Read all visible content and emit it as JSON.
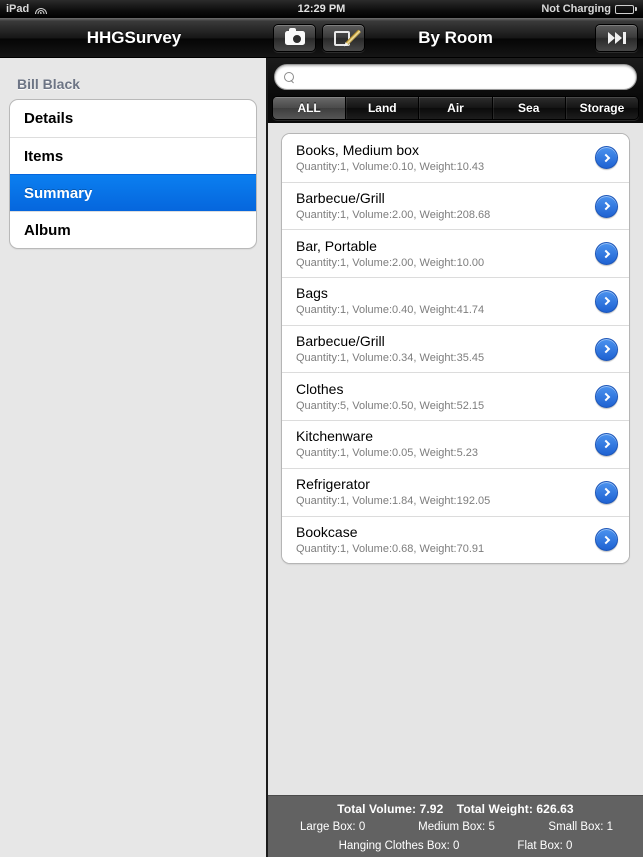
{
  "statusbar": {
    "device_label": "iPad",
    "wifi_icon": "wifi-icon",
    "time": "12:29 PM",
    "battery_label": "Not Charging",
    "battery_icon": "battery-icon"
  },
  "sidebar_navbar": {
    "title": "HHGSurvey"
  },
  "detail_navbar": {
    "camera_icon": "camera-icon",
    "compose_icon": "compose-icon",
    "title": "By Room",
    "skip_icon": "skip-forward-icon"
  },
  "sidebar": {
    "group_header": "Bill Black",
    "items": [
      {
        "label": "Details",
        "selected": false
      },
      {
        "label": "Items",
        "selected": false
      },
      {
        "label": "Summary",
        "selected": true
      },
      {
        "label": "Album",
        "selected": false
      }
    ]
  },
  "search": {
    "icon": "search-icon",
    "value": "",
    "placeholder": ""
  },
  "segmented_control": {
    "options": [
      "ALL",
      "Land",
      "Air",
      "Sea",
      "Storage"
    ],
    "selected": "ALL"
  },
  "items": [
    {
      "title": "Books, Medium box",
      "subtitle": "Quantity:1, Volume:0.10, Weight:10.43",
      "quantity": 1,
      "volume": "0.10",
      "weight": "10.43"
    },
    {
      "title": "Barbecue/Grill",
      "subtitle": "Quantity:1, Volume:2.00, Weight:208.68",
      "quantity": 1,
      "volume": "2.00",
      "weight": "208.68"
    },
    {
      "title": "Bar, Portable",
      "subtitle": "Quantity:1, Volume:2.00, Weight:10.00",
      "quantity": 1,
      "volume": "2.00",
      "weight": "10.00"
    },
    {
      "title": "Bags",
      "subtitle": "Quantity:1, Volume:0.40, Weight:41.74",
      "quantity": 1,
      "volume": "0.40",
      "weight": "41.74"
    },
    {
      "title": "Barbecue/Grill",
      "subtitle": "Quantity:1, Volume:0.34, Weight:35.45",
      "quantity": 1,
      "volume": "0.34",
      "weight": "35.45"
    },
    {
      "title": "Clothes",
      "subtitle": "Quantity:5, Volume:0.50, Weight:52.15",
      "quantity": 5,
      "volume": "0.50",
      "weight": "52.15"
    },
    {
      "title": "Kitchenware",
      "subtitle": "Quantity:1, Volume:0.05, Weight:5.23",
      "quantity": 1,
      "volume": "0.05",
      "weight": "5.23"
    },
    {
      "title": "Refrigerator",
      "subtitle": "Quantity:1, Volume:1.84, Weight:192.05",
      "quantity": 1,
      "volume": "1.84",
      "weight": "192.05"
    },
    {
      "title": "Bookcase",
      "subtitle": "Quantity:1, Volume:0.68, Weight:70.91",
      "quantity": 1,
      "volume": "0.68",
      "weight": "70.91"
    }
  ],
  "summary": {
    "total_volume": "Total Volume: 7.92",
    "total_weight": "Total Weight: 626.63",
    "large_box": "Large Box: 0",
    "medium_box": "Medium Box: 5",
    "small_box": "Small Box: 1",
    "hanging_clothes_box": "Hanging Clothes Box: 0",
    "flat_box": "Flat Box: 0"
  },
  "colors": {
    "accent_blue": "#0b7ff0",
    "disclosure_blue": "#2f76e0",
    "group_header": "#6d7585",
    "footer_gray": "#626262",
    "panel_gray": "#e5e5e5"
  }
}
